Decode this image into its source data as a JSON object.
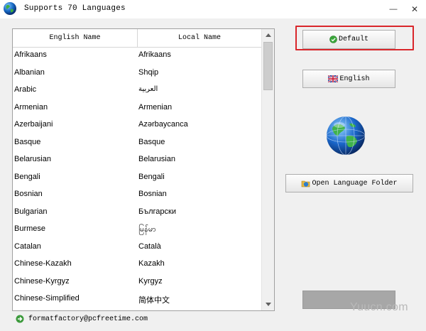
{
  "window": {
    "title": "Supports 70 Languages",
    "minimize_glyph": "—",
    "close_glyph": "✕"
  },
  "table": {
    "columns": [
      "English Name",
      "Local Name"
    ],
    "rows": [
      {
        "english": "Afrikaans",
        "local": "Afrikaans"
      },
      {
        "english": "Albanian",
        "local": "Shqip"
      },
      {
        "english": "Arabic",
        "local": "العربية"
      },
      {
        "english": "Armenian",
        "local": "Armenian"
      },
      {
        "english": "Azerbaijani",
        "local": "Azərbaycanca"
      },
      {
        "english": "Basque",
        "local": "Basque"
      },
      {
        "english": "Belarusian",
        "local": "Belarusian"
      },
      {
        "english": "Bengali",
        "local": "Bengali"
      },
      {
        "english": "Bosnian",
        "local": "Bosnian"
      },
      {
        "english": "Bulgarian",
        "local": "Български"
      },
      {
        "english": "Burmese",
        "local": "မြန်မာ"
      },
      {
        "english": "Catalan",
        "local": "Català"
      },
      {
        "english": "Chinese-Kazakh",
        "local": "Kazakh"
      },
      {
        "english": "Chinese-Kyrgyz",
        "local": "Kyrgyz"
      },
      {
        "english": "Chinese-Simplified",
        "local": "简体中文"
      }
    ]
  },
  "buttons": {
    "default_label": "Default",
    "english_label": "English",
    "open_folder_label": "Open Language Folder",
    "blank_label": ""
  },
  "footer": {
    "email": "formatfactory@pcfreetime.com"
  },
  "watermark": "Yuucn.com",
  "colors": {
    "highlight_border": "#d9262b",
    "background": "#f0f0f0"
  },
  "icons": {
    "app": "globe-icon",
    "default": "green-check-icon",
    "english": "uk-flag-icon",
    "folder": "folder-globe-icon",
    "footer": "green-arrow-icon"
  }
}
